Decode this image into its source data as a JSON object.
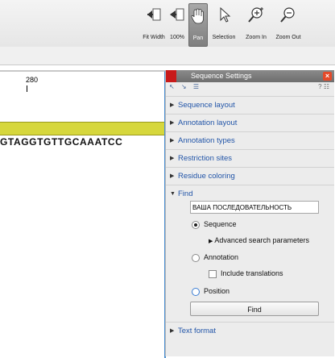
{
  "toolbar": {
    "buttons": [
      {
        "id": "fit-width",
        "label": "Fit Width",
        "icon": "fit-width-icon"
      },
      {
        "id": "zoom-100",
        "label": "100%",
        "icon": "zoom-100-icon"
      },
      {
        "id": "pan",
        "label": "Pan",
        "icon": "hand-icon",
        "active": true
      },
      {
        "id": "selection",
        "label": "Selection",
        "icon": "pointer-icon"
      },
      {
        "id": "zoom-in",
        "label": "Zoom In",
        "icon": "zoom-in-icon"
      },
      {
        "id": "zoom-out",
        "label": "Zoom Out",
        "icon": "zoom-out-icon"
      }
    ]
  },
  "editor": {
    "ruler_position": "280",
    "sequence": "GTAGGTGTTGCAAATCC",
    "annotation_color": "#d6d73c"
  },
  "panel": {
    "title": "Sequence Settings",
    "close_symbol": "×",
    "tools_left": "↖ ↘ ☰",
    "tools_right": "? ☷",
    "sections": {
      "sequence_layout": "Sequence layout",
      "annotation_layout": "Annotation layout",
      "annotation_types": "Annotation types",
      "restriction_sites": "Restriction sites",
      "residue_coloring": "Residue coloring",
      "find": "Find",
      "text_format": "Text format"
    },
    "find": {
      "search_value": "ВАША ПОСЛЕДОВАТЕЛЬНОСТЬ",
      "sequence_label": "Sequence",
      "advanced_label": "Advanced search parameters",
      "annotation_label": "Annotation",
      "include_translations_label": "Include translations",
      "position_label": "Position",
      "find_button": "Find",
      "selected_option": "Sequence"
    }
  }
}
